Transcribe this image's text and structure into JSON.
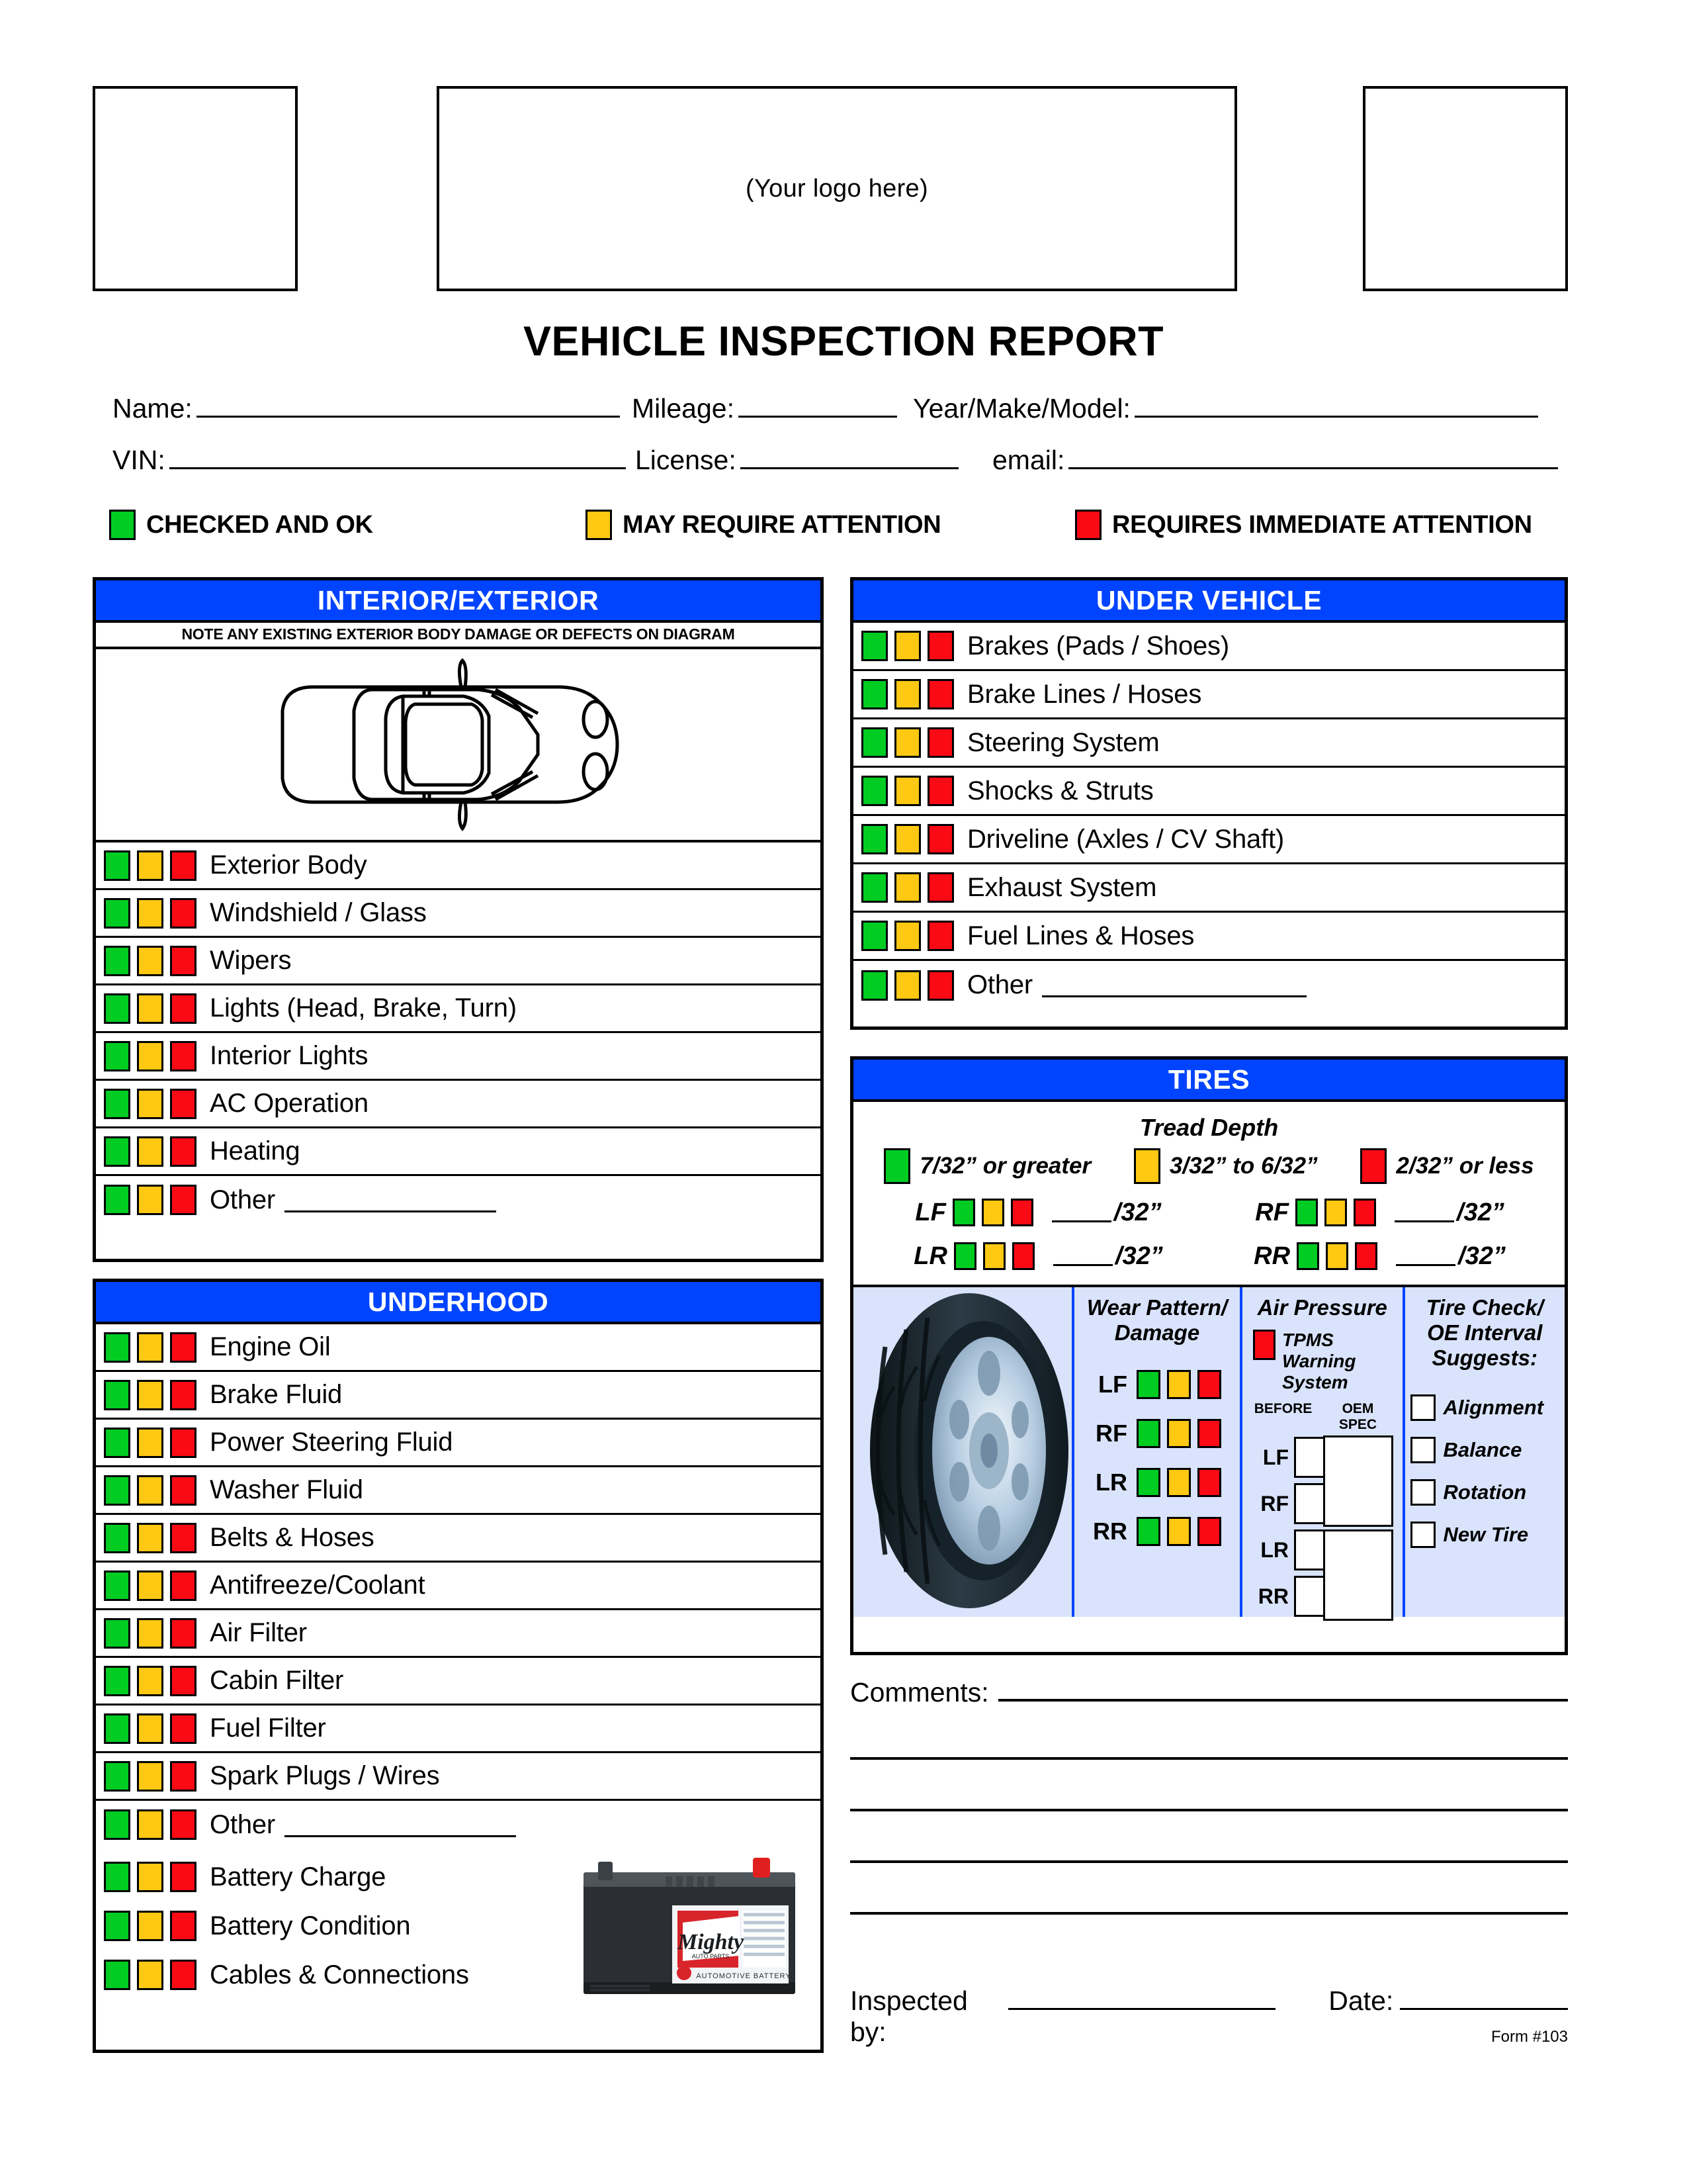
{
  "header": {
    "logo_placeholder": "(Your logo here)",
    "title": "VEHICLE INSPECTION REPORT"
  },
  "info_fields": {
    "name_label": "Name:",
    "mileage_label": "Mileage:",
    "year_make_model_label": "Year/Make/Model:",
    "vin_label": "VIN:",
    "license_label": "License:",
    "email_label": "email:",
    "name_value": "",
    "mileage_value": "",
    "year_make_model_value": "",
    "vin_value": "",
    "license_value": "",
    "email_value": ""
  },
  "legend": [
    {
      "color": "#00cc22",
      "label": "CHECKED AND OK"
    },
    {
      "color": "#ffc813",
      "label": "MAY REQUIRE ATTENTION"
    },
    {
      "color": "#fa0a14",
      "label": "REQUIRES IMMEDIATE ATTENTION"
    }
  ],
  "colors": {
    "green": "#00cc22",
    "yellow": "#ffc813",
    "red": "#fa0a14",
    "section_blue": "#0044ff",
    "tire_panel_bg": "#d9e3fb"
  },
  "interior_exterior": {
    "title": "INTERIOR/EXTERIOR",
    "note": "NOTE ANY EXISTING EXTERIOR BODY DAMAGE OR DEFECTS ON DIAGRAM",
    "diagram_name": "car-top-view-diagram",
    "items": [
      {
        "label": "Exterior Body",
        "has_blank": false
      },
      {
        "label": "Windshield / Glass",
        "has_blank": false
      },
      {
        "label": "Wipers",
        "has_blank": false
      },
      {
        "label": "Lights (Head, Brake, Turn)",
        "has_blank": false
      },
      {
        "label": "Interior Lights",
        "has_blank": false
      },
      {
        "label": "AC Operation",
        "has_blank": false
      },
      {
        "label": "Heating",
        "has_blank": false
      },
      {
        "label": "Other",
        "has_blank": true
      }
    ]
  },
  "underhood": {
    "title": "UNDERHOOD",
    "items": [
      {
        "label": "Engine Oil",
        "has_blank": false
      },
      {
        "label": "Brake Fluid",
        "has_blank": false
      },
      {
        "label": "Power Steering Fluid",
        "has_blank": false
      },
      {
        "label": "Washer Fluid",
        "has_blank": false
      },
      {
        "label": "Belts & Hoses",
        "has_blank": false
      },
      {
        "label": "Antifreeze/Coolant",
        "has_blank": false
      },
      {
        "label": "Air Filter",
        "has_blank": false
      },
      {
        "label": "Cabin Filter",
        "has_blank": false
      },
      {
        "label": "Fuel Filter",
        "has_blank": false
      },
      {
        "label": "Spark Plugs / Wires",
        "has_blank": false
      },
      {
        "label": "Other",
        "has_blank": true
      }
    ],
    "battery_items": [
      {
        "label": "Battery Charge"
      },
      {
        "label": "Battery Condition"
      },
      {
        "label": "Cables & Connections"
      }
    ],
    "battery_image": {
      "name": "mighty-battery-photo",
      "brand": "Mighty",
      "brand_sub": "AUTO PARTS",
      "caption": "AUTOMOTIVE BATTERY"
    }
  },
  "under_vehicle": {
    "title": "UNDER VEHICLE",
    "items": [
      {
        "label": "Brakes (Pads / Shoes)",
        "has_blank": false
      },
      {
        "label": "Brake Lines / Hoses",
        "has_blank": false
      },
      {
        "label": "Steering System",
        "has_blank": false
      },
      {
        "label": "Shocks & Struts",
        "has_blank": false
      },
      {
        "label": "Driveline (Axles / CV Shaft)",
        "has_blank": false
      },
      {
        "label": "Exhaust System",
        "has_blank": false
      },
      {
        "label": "Fuel Lines & Hoses",
        "has_blank": false
      },
      {
        "label": "Other",
        "has_blank": true
      }
    ]
  },
  "tires": {
    "title": "TIRES",
    "tread_depth_title": "Tread Depth",
    "tread_legend": [
      {
        "color": "#00cc22",
        "label": "7/32” or greater"
      },
      {
        "color": "#ffc813",
        "label": "3/32” to 6/32”"
      },
      {
        "color": "#fa0a14",
        "label": "2/32” or less"
      }
    ],
    "tread_positions": [
      {
        "pos": "LF",
        "value": "",
        "unit": "/32”"
      },
      {
        "pos": "RF",
        "value": "",
        "unit": "/32”"
      },
      {
        "pos": "LR",
        "value": "",
        "unit": "/32”"
      },
      {
        "pos": "RR",
        "value": "",
        "unit": "/32”"
      }
    ],
    "tire_photo_name": "tire-wheel-photo",
    "wear_pattern": {
      "title_line1": "Wear Pattern/",
      "title_line2": "Damage",
      "positions": [
        "LF",
        "RF",
        "LR",
        "RR"
      ]
    },
    "air_pressure": {
      "title": "Air Pressure",
      "tpms_label": "TPMS Warning System",
      "col_before": "BEFORE",
      "col_oem": "OEM SPEC",
      "positions": [
        "LF",
        "RF",
        "LR",
        "RR"
      ],
      "before_values": [
        "",
        "",
        "",
        ""
      ],
      "oem_values": [
        "",
        ""
      ]
    },
    "tire_check": {
      "title_line1": "Tire Check/",
      "title_line2": "OE Interval",
      "title_line3": "Suggests:",
      "options": [
        "Alignment",
        "Balance",
        "Rotation",
        "New Tire"
      ]
    }
  },
  "comments": {
    "label": "Comments:",
    "lines": [
      "",
      "",
      "",
      "",
      ""
    ]
  },
  "footer": {
    "inspected_by_label": "Inspected by:",
    "inspected_by_value": "",
    "date_label": "Date:",
    "date_value": "",
    "form_number": "Form #103"
  }
}
